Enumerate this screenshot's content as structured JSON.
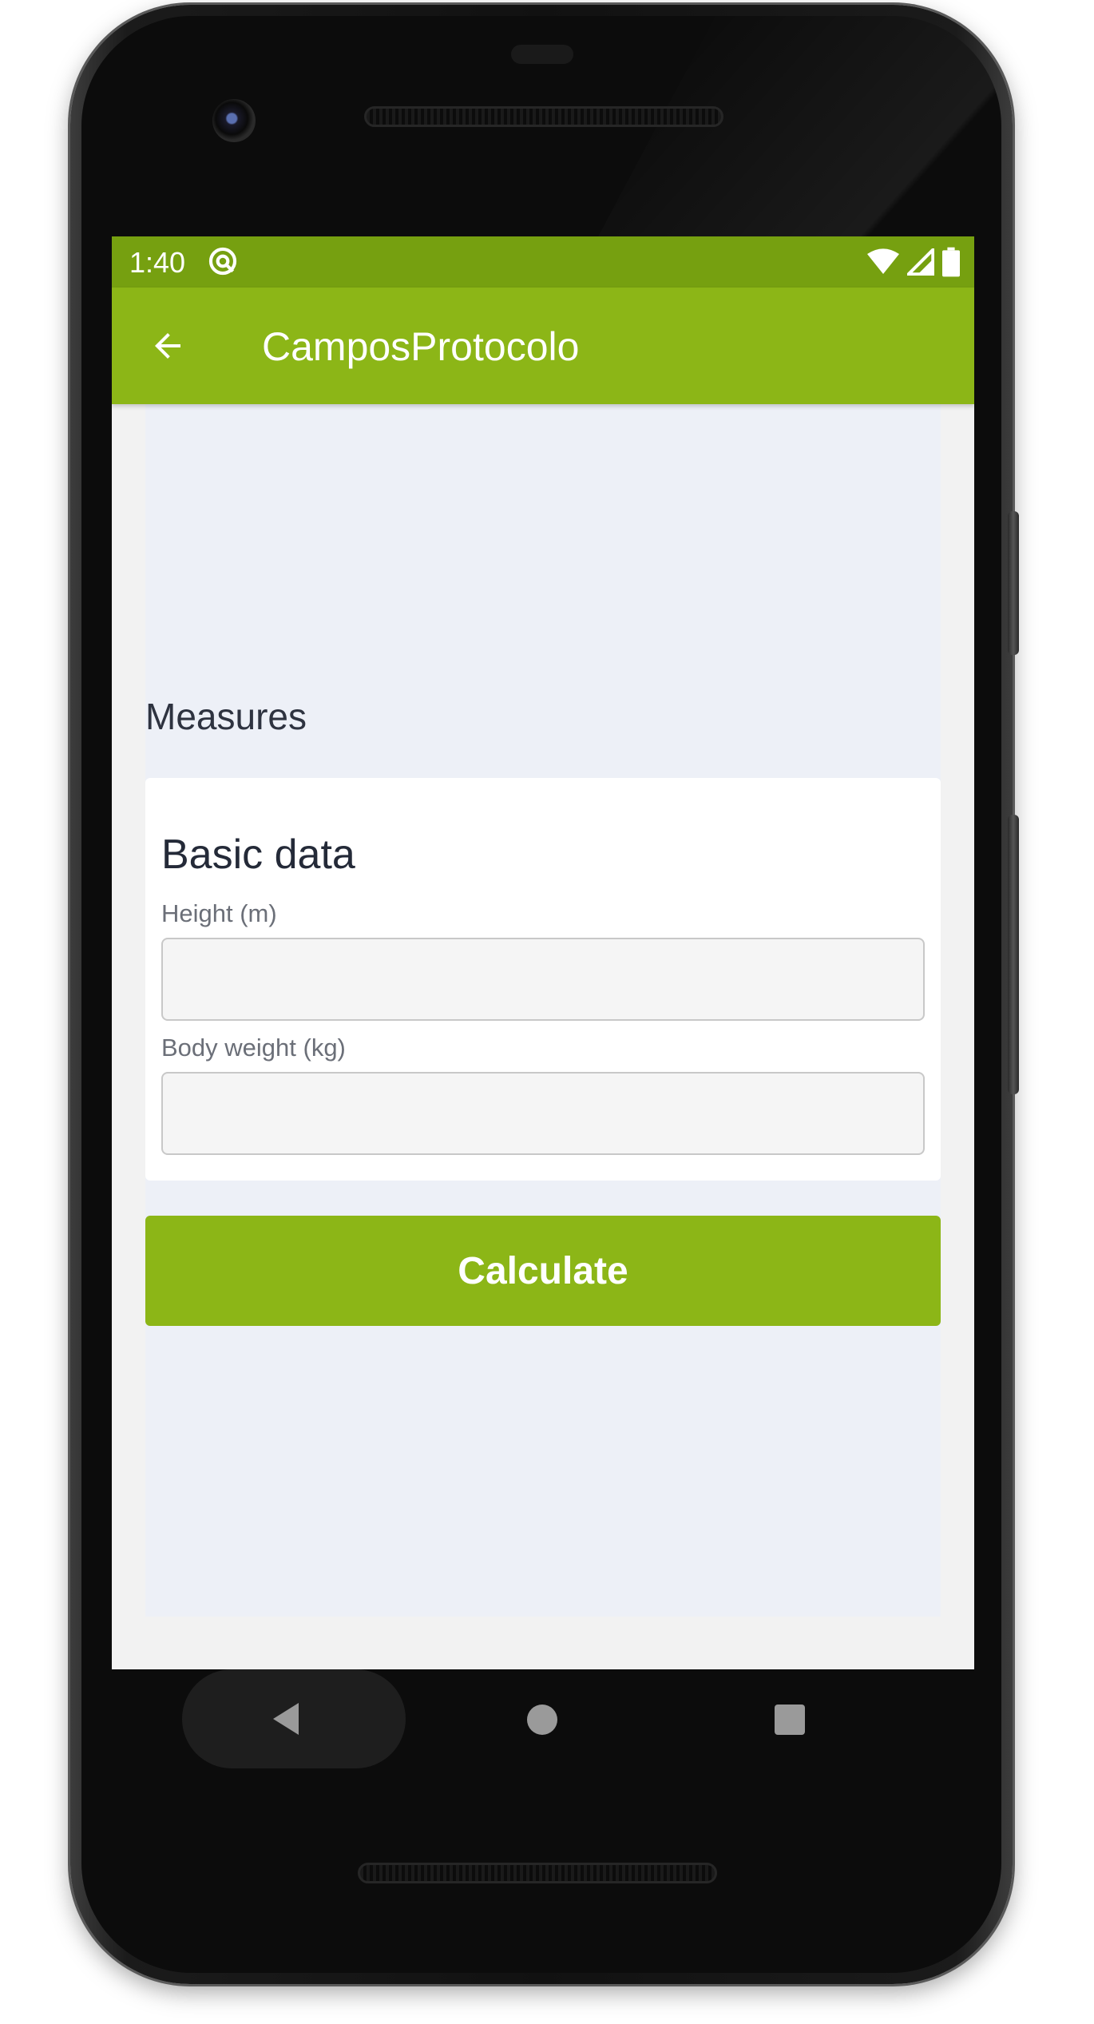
{
  "status_bar": {
    "time": "1:40",
    "notification_icon": "at-sign-icon",
    "icons": [
      "wifi-icon",
      "signal-icon",
      "battery-icon"
    ]
  },
  "app_bar": {
    "back_icon": "arrow-left-icon",
    "title": "CamposProtocolo"
  },
  "main": {
    "section_title": "Measures",
    "card": {
      "title": "Basic data",
      "fields": [
        {
          "label": "Height (m)",
          "value": "",
          "placeholder": ""
        },
        {
          "label": "Body weight (kg)",
          "value": "",
          "placeholder": ""
        }
      ]
    },
    "calculate_label": "Calculate"
  },
  "navigation": {
    "back_icon": "nav-back-triangle-icon",
    "home_icon": "nav-home-circle-icon",
    "recents_icon": "nav-recents-square-icon"
  },
  "colors": {
    "status_bar": "#76a010",
    "accent": "#8cb617",
    "content_background": "#edf0f7",
    "card_background": "#ffffff"
  }
}
